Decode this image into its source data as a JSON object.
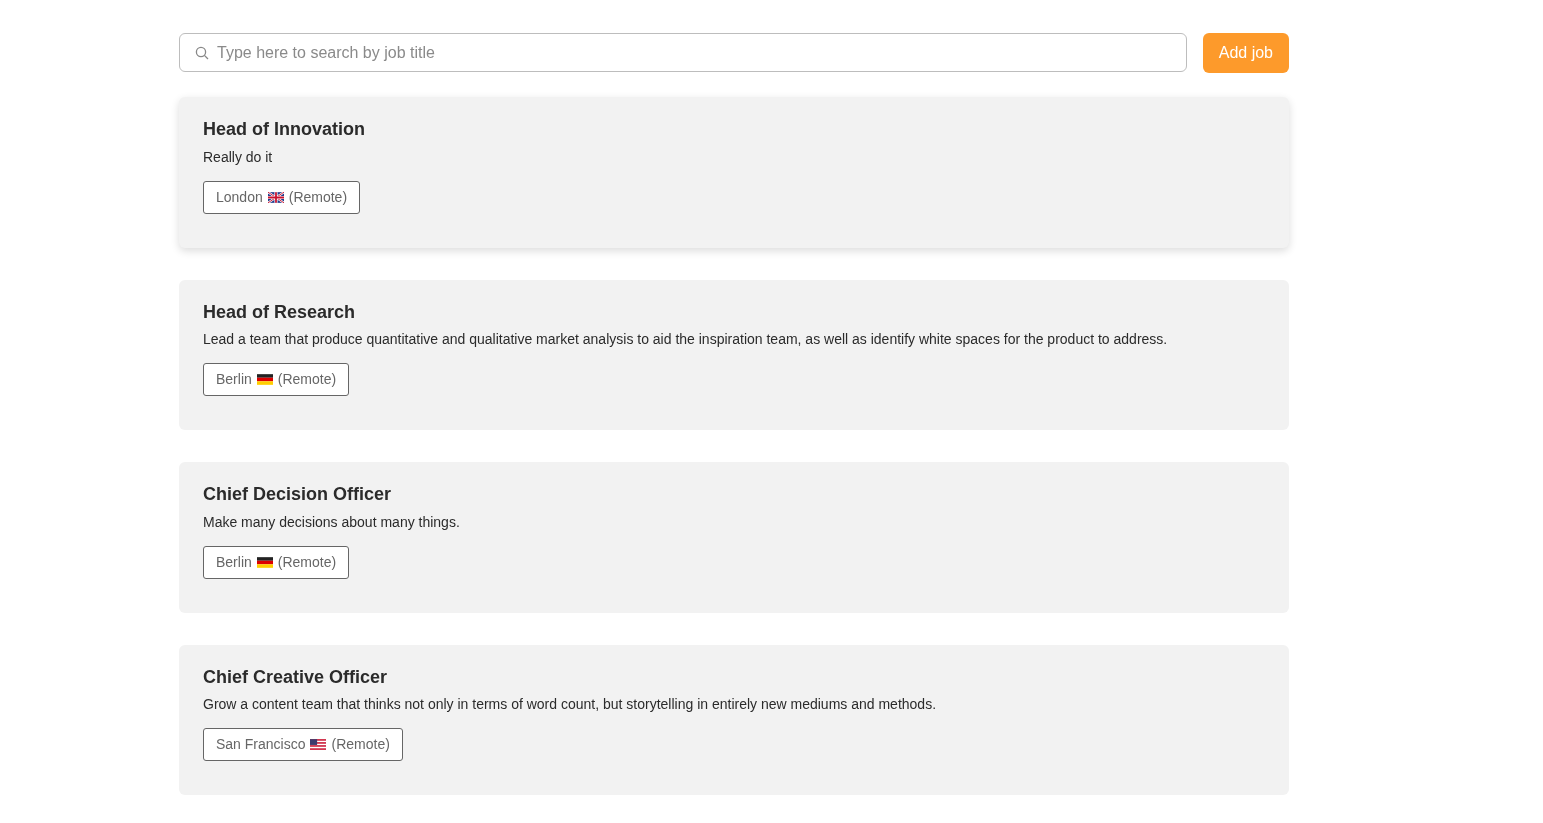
{
  "search": {
    "placeholder": "Type here to search by job title"
  },
  "add_button": "Add job",
  "jobs": [
    {
      "title": "Head of Innovation",
      "description": "Really do it",
      "location": "London",
      "kind": "gb",
      "remote": "(Remote)",
      "raised": true
    },
    {
      "title": "Head of Research",
      "description": "Lead a team that produce quantitative and qualitative market analysis to aid the inspiration team, as well as identify white spaces for the product to address.",
      "location": "Berlin",
      "kind": "de",
      "remote": "(Remote)",
      "raised": false
    },
    {
      "title": "Chief Decision Officer",
      "description": "Make many decisions about many things.",
      "location": "Berlin",
      "kind": "de",
      "remote": "(Remote)",
      "raised": false
    },
    {
      "title": "Chief Creative Officer",
      "description": "Grow a content team that thinks not only in terms of word count, but storytelling in entirely new mediums and methods.",
      "location": "San Francisco",
      "kind": "us",
      "remote": "(Remote)",
      "raised": false
    }
  ]
}
